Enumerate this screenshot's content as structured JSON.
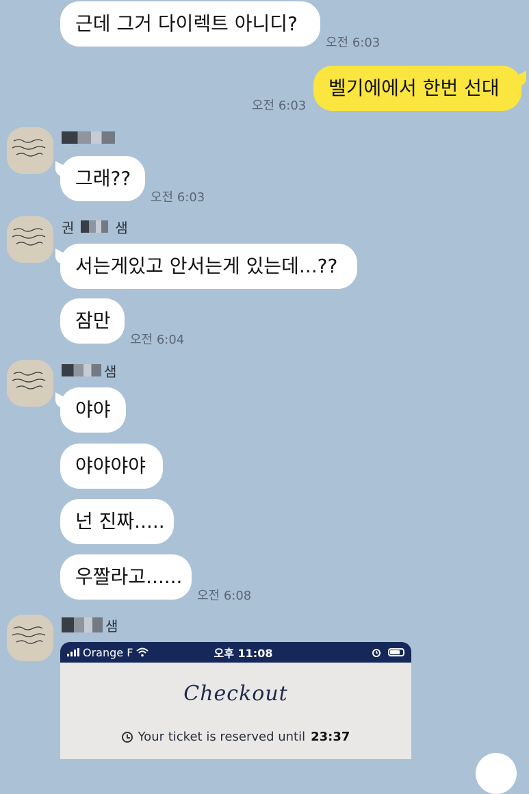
{
  "messages": {
    "m1": {
      "text": "근데 그거 다이렉트 아니디?",
      "time": "오전 6:03"
    },
    "m2": {
      "text": "벨기에에서 한번 선대",
      "time": "오전 6:03"
    },
    "m3": {
      "sender_fragment": "",
      "text": "그래??",
      "time": "오전 6:03"
    },
    "m4": {
      "sender_first": "권",
      "sender_last": "샘",
      "text": "서는게있고 안서는게 있는데...??"
    },
    "m5": {
      "text": "잠만",
      "time": "오전 6:04"
    },
    "m6": {
      "sender_last": "샘",
      "text": "야야"
    },
    "m7": {
      "text": "야야야야"
    },
    "m8": {
      "text": "넌 진짜....."
    },
    "m9": {
      "text": "우짤라고......",
      "time": "오전 6:08"
    },
    "m10": {
      "sender_last": "샘"
    }
  },
  "attachment": {
    "status_carrier": "Orange F",
    "status_time": "오후 11:08",
    "title": "Checkout",
    "reserved_prefix": "Your ticket is reserved until",
    "reserved_time": "23:37"
  },
  "colors": {
    "background": "#abc1d6",
    "mine_bubble": "#fbe53f",
    "their_bubble": "#ffffff"
  },
  "icons": [
    "wifi-icon",
    "alarm-icon",
    "battery-icon",
    "clock-icon",
    "signal-icon"
  ]
}
